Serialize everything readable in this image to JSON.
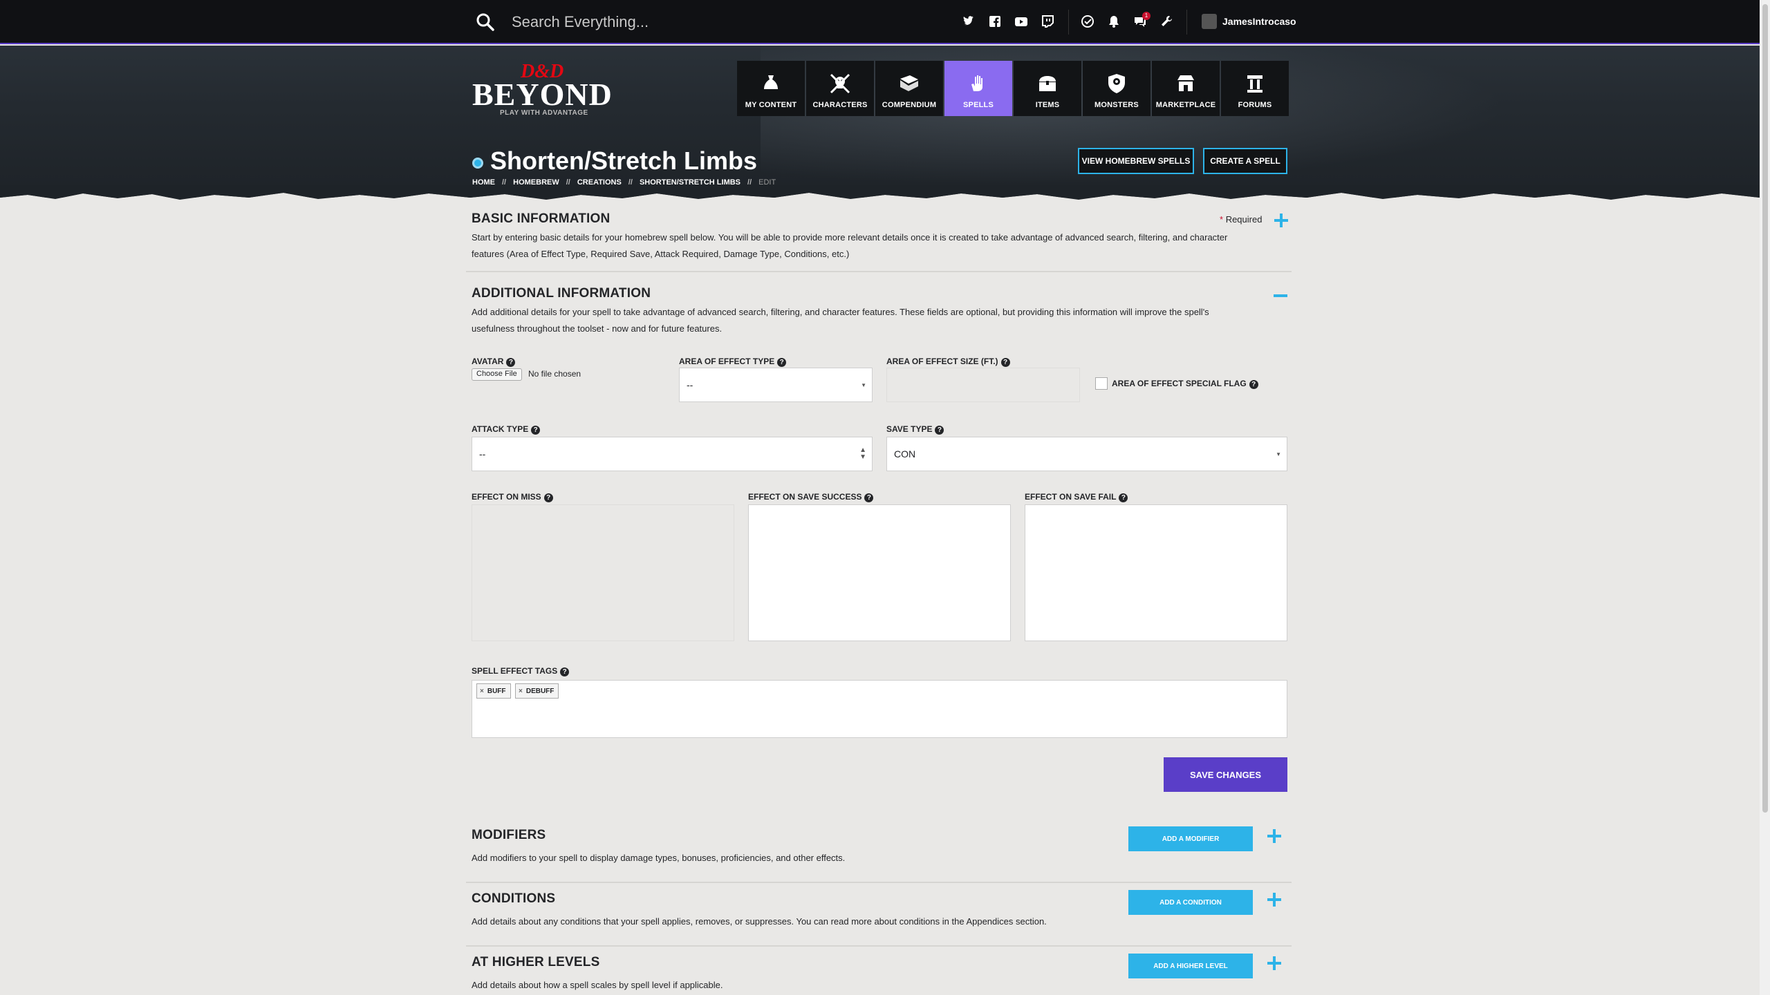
{
  "topbar": {
    "search_placeholder": "Search Everything...",
    "notif_count": "1",
    "username": "JamesIntrocaso"
  },
  "logo": {
    "dd": "D&D",
    "beyond": "BEYOND",
    "tagline": "PLAY WITH ADVANTAGE"
  },
  "nav": [
    {
      "label": "MY CONTENT",
      "icon": "bag-icon"
    },
    {
      "label": "CHARACTERS",
      "icon": "skull-crossbones-icon"
    },
    {
      "label": "COMPENDIUM",
      "icon": "book-icon"
    },
    {
      "label": "SPELLS",
      "icon": "hand-spell-icon",
      "active": true
    },
    {
      "label": "ITEMS",
      "icon": "chest-icon"
    },
    {
      "label": "MONSTERS",
      "icon": "monster-shield-icon"
    },
    {
      "label": "MARKETPLACE",
      "icon": "store-icon"
    },
    {
      "label": "FORUMS",
      "icon": "forum-pillar-icon"
    }
  ],
  "page": {
    "title": "Shorten/Stretch Limbs",
    "breadcrumb": [
      "HOME",
      "HOMEBREW",
      "CREATIONS",
      "SHORTEN/STRETCH LIMBS",
      "EDIT"
    ],
    "breadcrumb_sep": "//",
    "view_homebrew_btn": "VIEW HOMEBREW SPELLS",
    "create_spell_btn": "CREATE A SPELL"
  },
  "basic": {
    "title": "BASIC INFORMATION",
    "required_star": "*",
    "required_label": "Required",
    "desc_line1": "Start by entering basic details for your homebrew spell below. You will be able to provide more relevant details once it is created to take advantage of advanced search, filtering, and character",
    "desc_line2": "features (Area of Effect Type, Required Save, Attack Required, Damage Type, Conditions, etc.)"
  },
  "additional": {
    "title": "ADDITIONAL INFORMATION",
    "desc_line1": "Add additional details for your spell to take advantage of advanced search, filtering, and character features. These fields are optional, but providing this information will improve the spell's",
    "desc_line2": "usefulness throughout the toolset - now and for future features.",
    "avatar_label": "AVATAR",
    "choose_file": "Choose File",
    "no_file": "No file chosen",
    "aoe_type_label": "AREA OF EFFECT TYPE",
    "aoe_type_value": "--",
    "aoe_size_label": "AREA OF EFFECT SIZE (FT.)",
    "aoe_size_value": "",
    "aoe_flag_label": "AREA OF EFFECT SPECIAL FLAG",
    "attack_type_label": "ATTACK TYPE",
    "attack_type_value": "--",
    "save_type_label": "SAVE TYPE",
    "save_type_value": "CON",
    "effect_miss_label": "EFFECT ON MISS",
    "effect_success_label": "EFFECT ON SAVE SUCCESS",
    "effect_fail_label": "EFFECT ON SAVE FAIL",
    "tags_label": "SPELL EFFECT TAGS",
    "tags": [
      "BUFF",
      "DEBUFF"
    ],
    "tag_remove": "×",
    "help": "?",
    "save_btn": "SAVE CHANGES"
  },
  "modifiers": {
    "title": "MODIFIERS",
    "desc": "Add modifiers to your spell to display damage types, bonuses, proficiencies, and other effects.",
    "btn": "ADD A MODIFIER"
  },
  "conditions": {
    "title": "CONDITIONS",
    "desc": "Add details about any conditions that your spell applies, removes, or suppresses. You can read more about conditions in the Appendices section.",
    "btn": "ADD A CONDITION"
  },
  "higher": {
    "title": "AT HIGHER LEVELS",
    "desc": "Add details about how a spell scales by spell level if applicable.",
    "btn": "ADD A HIGHER LEVEL"
  },
  "colors": {
    "accent": "#5a3ec8",
    "blue": "#2db3e8",
    "tab_active": "#8a6bf0"
  }
}
